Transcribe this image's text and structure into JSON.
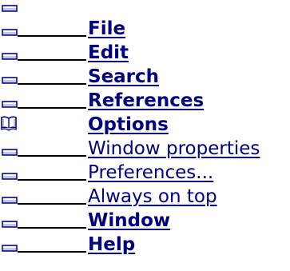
{
  "menu": {
    "items": [
      {
        "label": "File",
        "style": "bold",
        "icon": "menu-item-icon"
      },
      {
        "label": "Edit",
        "style": "bold",
        "icon": "menu-item-icon"
      },
      {
        "label": "Search",
        "style": "bold",
        "icon": "menu-item-icon"
      },
      {
        "label": "References",
        "style": "bold",
        "icon": "menu-item-icon"
      },
      {
        "label": "Options",
        "style": "bold",
        "icon": "open-book-icon"
      },
      {
        "label": "Window properties",
        "style": "plain",
        "icon": "menu-item-icon"
      },
      {
        "label": "Preferences...",
        "style": "plain",
        "icon": "menu-item-icon"
      },
      {
        "label": "Always on top",
        "style": "plain",
        "icon": "menu-item-icon"
      },
      {
        "label": "Window",
        "style": "bold",
        "icon": "menu-item-icon"
      },
      {
        "label": "Help",
        "style": "bold",
        "icon": "menu-item-icon"
      }
    ]
  },
  "colors": {
    "link_text": "#000080",
    "icon_fill": "#c0c8e8",
    "icon_border": "#000080",
    "book_border": "#000080"
  }
}
